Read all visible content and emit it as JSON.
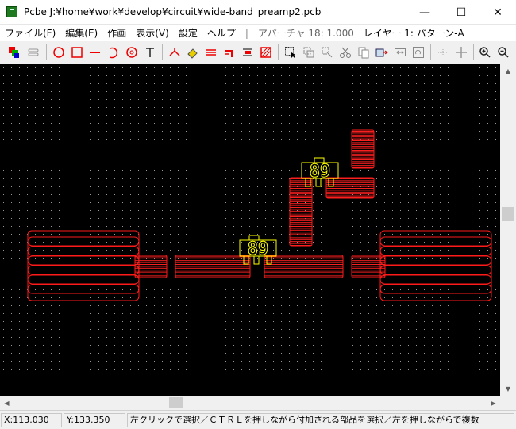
{
  "window": {
    "title": "Pcbe J:¥home¥work¥develop¥circuit¥wide-band_preamp2.pcb",
    "minimize_glyph": "—",
    "maximize_glyph": "☐",
    "close_glyph": "✕"
  },
  "menu": {
    "items": [
      "ファイル(F)",
      "編集(E)",
      "作画",
      "表示(V)",
      "設定",
      "ヘルプ"
    ],
    "separator": "|",
    "aperture": "アパーチャ 18: 1.000",
    "layer": "レイヤー 1: パターン-A"
  },
  "toolbar": {
    "icons": [
      "layer-color-icon",
      "layer-toggle-icon",
      "circle-icon",
      "rectangle-icon",
      "line-icon",
      "arc-icon",
      "pad-icon",
      "text-icon",
      "junction-icon",
      "eraser-icon",
      "bus-icon",
      "corner-icon",
      "via-icon",
      "fill-icon",
      "select-icon",
      "copy-region-icon",
      "move-icon",
      "cut-icon",
      "copy-icon",
      "paste-icon",
      "mirror-icon",
      "rotate-icon",
      "undo-icon",
      "grid-icon",
      "crosshair-icon",
      "zoom-in-icon",
      "zoom-out-icon"
    ]
  },
  "canvas": {
    "background": "#000000",
    "trace_color": "#ff0000",
    "component_color": "#ffff00",
    "components": [
      {
        "label": "89",
        "name": "transistor-q1"
      },
      {
        "label": "89",
        "name": "transistor-q2"
      }
    ]
  },
  "status": {
    "x": "X:113.030",
    "y": "Y:133.350",
    "message": "左クリックで選択／ＣＴＲＬを押しながら付加される部品を選択／左を押しながらで複数"
  }
}
